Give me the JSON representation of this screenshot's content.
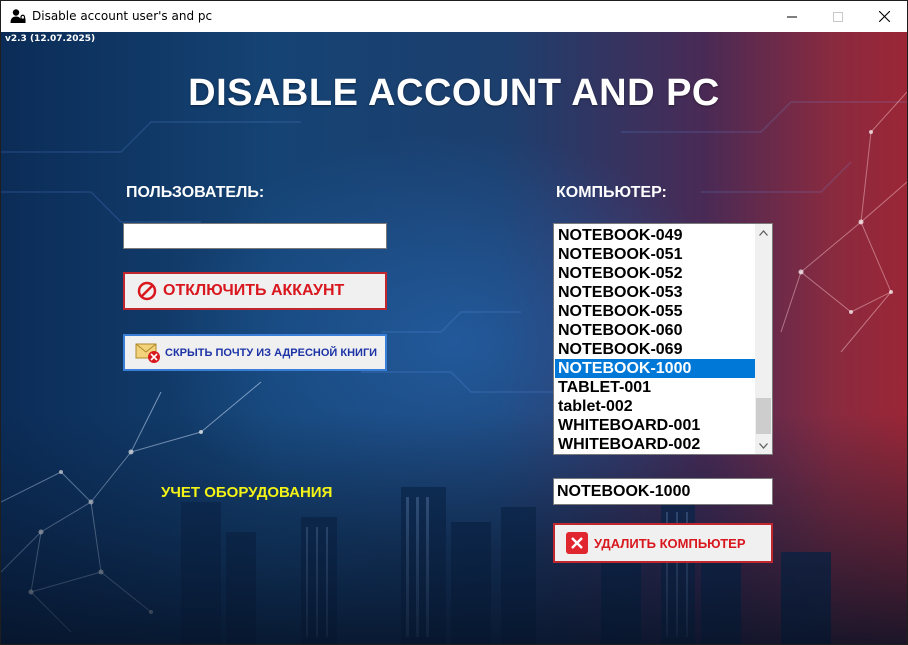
{
  "window": {
    "title": "Disable account user's and pc",
    "icons": {
      "app": "user-lock-icon",
      "minimize": "minimize-icon",
      "maximize": "maximize-icon",
      "close": "close-icon"
    }
  },
  "version": "v2.3 (12.07.2025)",
  "main_title": "DISABLE ACCOUNT AND PC",
  "user_section": {
    "label": "ПОЛЬЗОВАТЕЛЬ:",
    "input_value": "",
    "disable_button": {
      "label": "ОТКЛЮЧИТЬ АККАУНТ",
      "icon": "prohibited-icon"
    },
    "hide_mail_button": {
      "label": "СКРЫТЬ ПОЧТУ ИЗ АДРЕСНОЙ КНИГИ",
      "icon": "mail-remove-icon"
    },
    "hardware_link": "УЧЕТ ОБОРУДОВАНИЯ"
  },
  "computer_section": {
    "label": "КОМПЬЮТЕР:",
    "list": [
      "NOTEBOOK-049",
      "NOTEBOOK-051",
      "NOTEBOOK-052",
      "NOTEBOOK-053",
      "NOTEBOOK-055",
      "NOTEBOOK-060",
      "NOTEBOOK-069",
      "NOTEBOOK-1000",
      "TABLET-001",
      "tablet-002",
      "WHITEBOARD-001",
      "WHITEBOARD-002"
    ],
    "selected_index": 7,
    "input_value": "NOTEBOOK-1000",
    "delete_button": {
      "label": "УДАЛИТЬ КОМПЬЮТЕР",
      "icon": "delete-x-icon"
    }
  },
  "colors": {
    "danger": "#d9171e",
    "link_blue": "#1c33a6",
    "selection": "#0078d7",
    "hardware_link": "#f3f316"
  }
}
